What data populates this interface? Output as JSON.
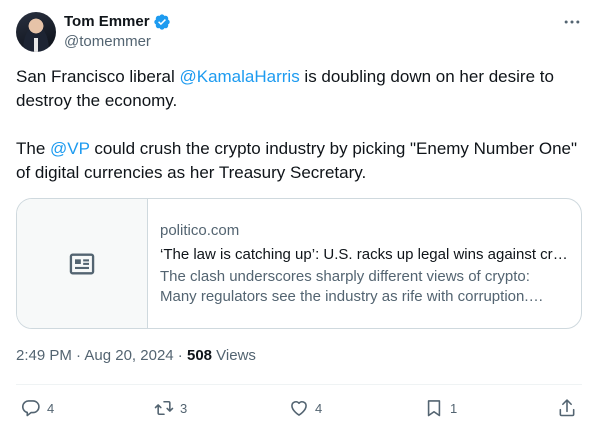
{
  "author": {
    "name": "Tom Emmer",
    "handle": "@tomemmer",
    "verified_color": "#1d9bf0"
  },
  "tweet": {
    "p1": {
      "before": "San Francisco liberal ",
      "mention": "@KamalaHarris",
      "after": " is doubling down on her desire to destroy the economy."
    },
    "p2": {
      "before": "The ",
      "mention": "@VP",
      "after": " could crush the crypto industry by picking \"Enemy Number One\" of digital currencies as her Treasury Secretary."
    }
  },
  "card": {
    "icon": "article-icon",
    "domain": "politico.com",
    "title": "‘The law is catching up’: U.S. racks up legal wins against crypto",
    "description": "The clash underscores sharply different views of crypto: Many regulators see the industry as rife with corruption. Others see potential"
  },
  "meta": {
    "time": "2:49 PM",
    "sep1": " · ",
    "date": "Aug 20, 2024",
    "sep2": " · ",
    "views_count": "508",
    "views_label": " Views"
  },
  "actions": {
    "reply": {
      "icon": "reply-icon",
      "count": "4"
    },
    "repost": {
      "icon": "repost-icon",
      "count": "3"
    },
    "like": {
      "icon": "heart-icon",
      "count": "4"
    },
    "bookmark": {
      "icon": "bookmark-icon",
      "count": "1"
    },
    "share": {
      "icon": "share-icon"
    }
  },
  "colors": {
    "link": "#1d9bf0",
    "secondary_text": "#536471",
    "border": "#cfd9de"
  }
}
